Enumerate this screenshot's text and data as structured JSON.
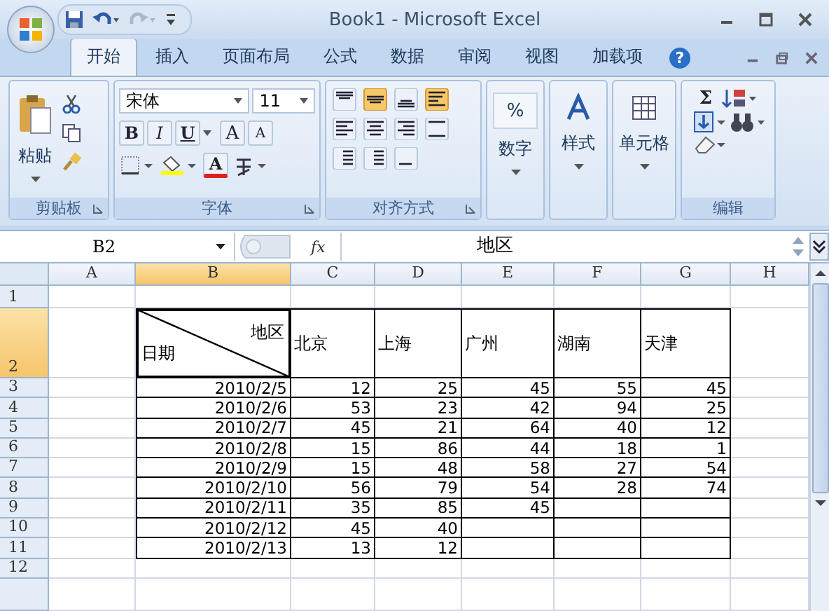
{
  "window": {
    "title": "Book1 - Microsoft Excel"
  },
  "tabs": [
    {
      "label": "开始",
      "selected": true
    },
    {
      "label": "插入",
      "selected": false
    },
    {
      "label": "页面布局",
      "selected": false
    },
    {
      "label": "公式",
      "selected": false
    },
    {
      "label": "数据",
      "selected": false
    },
    {
      "label": "审阅",
      "selected": false
    },
    {
      "label": "视图",
      "selected": false
    },
    {
      "label": "加载项",
      "selected": false
    }
  ],
  "help_button": "?",
  "ribbon": {
    "clipboard": {
      "label": "剪贴板",
      "paste": "粘贴"
    },
    "font": {
      "label": "字体",
      "font_name": "宋体",
      "font_size": "11",
      "bold": "B",
      "italic": "I",
      "underline": "U",
      "grow": "A",
      "shrink": "A",
      "font_color": "A"
    },
    "alignment": {
      "label": "对齐方式",
      "buttons": [
        {
          "kind": "top",
          "selected": false
        },
        {
          "kind": "middle",
          "selected": true
        },
        {
          "kind": "bottom",
          "selected": false
        },
        {
          "kind": "wrap",
          "selected": true
        },
        {
          "kind": "left",
          "selected": false
        },
        {
          "kind": "center",
          "selected": false
        },
        {
          "kind": "right",
          "selected": false
        },
        {
          "kind": "merge",
          "selected": false
        },
        {
          "kind": "outdent",
          "selected": false
        },
        {
          "kind": "indent",
          "selected": false
        },
        {
          "kind": "orientation",
          "selected": false
        }
      ]
    },
    "number": {
      "label": "数字",
      "symbol": "%"
    },
    "styles": {
      "label": "样式"
    },
    "cells": {
      "label": "单元格"
    },
    "editing": {
      "label": "编辑",
      "sum": "Σ"
    }
  },
  "formula_bar": {
    "name_box": "B2",
    "function_button": "fx",
    "formula": "地区"
  },
  "columns": [
    {
      "label": "A",
      "selected": false
    },
    {
      "label": "B",
      "selected": true
    },
    {
      "label": "C",
      "selected": false
    },
    {
      "label": "D",
      "selected": false
    },
    {
      "label": "E",
      "selected": false
    },
    {
      "label": "F",
      "selected": false
    },
    {
      "label": "G",
      "selected": false
    },
    {
      "label": "H",
      "selected": false
    }
  ],
  "rows": [
    {
      "number": "1",
      "kind": "empty",
      "selected": false
    },
    {
      "number": "2",
      "kind": "header",
      "selected": true,
      "diagonal": {
        "top": "地区",
        "bottom": "日期",
        "selected": true
      },
      "cells": [
        null,
        null,
        "北京",
        "上海",
        "广州",
        "湖南",
        "天津",
        null
      ]
    },
    {
      "number": "3",
      "kind": "data",
      "selected": false,
      "cells": [
        null,
        "2010/2/5",
        "12",
        "25",
        "45",
        "55",
        "45",
        null
      ]
    },
    {
      "number": "4",
      "kind": "data",
      "selected": false,
      "cells": [
        null,
        "2010/2/6",
        "53",
        "23",
        "42",
        "94",
        "25",
        null
      ]
    },
    {
      "number": "5",
      "kind": "data",
      "selected": false,
      "cells": [
        null,
        "2010/2/7",
        "45",
        "21",
        "64",
        "40",
        "12",
        null
      ]
    },
    {
      "number": "6",
      "kind": "data",
      "selected": false,
      "cells": [
        null,
        "2010/2/8",
        "15",
        "86",
        "44",
        "18",
        "1",
        null
      ]
    },
    {
      "number": "7",
      "kind": "data",
      "selected": false,
      "cells": [
        null,
        "2010/2/9",
        "15",
        "48",
        "58",
        "27",
        "54",
        null
      ]
    },
    {
      "number": "8",
      "kind": "data",
      "selected": false,
      "cells": [
        null,
        "2010/2/10",
        "56",
        "79",
        "54",
        "28",
        "74",
        null
      ]
    },
    {
      "number": "9",
      "kind": "data",
      "selected": false,
      "cells": [
        null,
        "2010/2/11",
        "35",
        "85",
        "45",
        null,
        null,
        null
      ]
    },
    {
      "number": "10",
      "kind": "data",
      "selected": false,
      "cells": [
        null,
        "2010/2/12",
        "45",
        "40",
        null,
        null,
        null,
        null
      ]
    },
    {
      "number": "11",
      "kind": "data",
      "selected": false,
      "cells": [
        null,
        "2010/2/13",
        "13",
        "12",
        null,
        null,
        null,
        null
      ]
    },
    {
      "number": "12",
      "kind": "empty",
      "selected": false
    }
  ]
}
